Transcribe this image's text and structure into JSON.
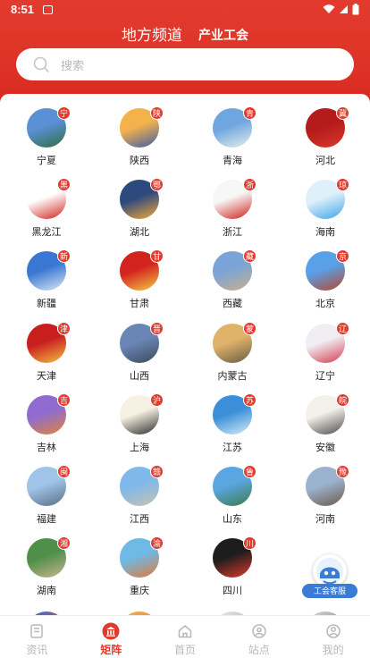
{
  "status_bar": {
    "time": "8:51",
    "wifi_icon": "wifi-icon",
    "signal_icon": "signal-icon",
    "battery_icon": "battery-icon"
  },
  "header": {
    "tab_active": "地方频道",
    "tab_other": "产业工会"
  },
  "search": {
    "placeholder": "搜索",
    "icon": "search-icon"
  },
  "regions": [
    {
      "name": "宁夏",
      "badge": "宁",
      "colors": [
        "#5b8fd6",
        "#2e6e3e"
      ]
    },
    {
      "name": "陕西",
      "badge": "陕",
      "colors": [
        "#f4b24b",
        "#3b5da8"
      ]
    },
    {
      "name": "青海",
      "badge": "青",
      "colors": [
        "#6fa6df",
        "#e7efe9"
      ]
    },
    {
      "name": "河北",
      "badge": "冀",
      "colors": [
        "#b51b1b",
        "#d8382b"
      ]
    },
    {
      "name": "黑龙江",
      "badge": "黑",
      "colors": [
        "#ffffff",
        "#d0211c"
      ]
    },
    {
      "name": "湖北",
      "badge": "鄂",
      "colors": [
        "#2d4a7e",
        "#f3a93a"
      ]
    },
    {
      "name": "浙江",
      "badge": "浙",
      "colors": [
        "#f7f7f7",
        "#d0211c"
      ]
    },
    {
      "name": "海南",
      "badge": "琼",
      "colors": [
        "#dff0fb",
        "#3ea6e6"
      ]
    },
    {
      "name": "新疆",
      "badge": "新",
      "colors": [
        "#3a77d2",
        "#dbe7f6"
      ]
    },
    {
      "name": "甘肃",
      "badge": "甘",
      "colors": [
        "#d3231d",
        "#f3c948"
      ]
    },
    {
      "name": "西藏",
      "badge": "藏",
      "colors": [
        "#7aa4d6",
        "#c9b08e"
      ]
    },
    {
      "name": "北京",
      "badge": "京",
      "colors": [
        "#5aa0e8",
        "#b5462c"
      ]
    },
    {
      "name": "天津",
      "badge": "津",
      "colors": [
        "#c81e1e",
        "#f4c043"
      ]
    },
    {
      "name": "山西",
      "badge": "晋",
      "colors": [
        "#6a86b5",
        "#3b4a5c"
      ]
    },
    {
      "name": "内蒙古",
      "badge": "蒙",
      "colors": [
        "#e0b36a",
        "#6b5b44"
      ]
    },
    {
      "name": "辽宁",
      "badge": "辽",
      "colors": [
        "#f0eef3",
        "#d63a4f"
      ]
    },
    {
      "name": "吉林",
      "badge": "吉",
      "colors": [
        "#8f6bd0",
        "#e0853a"
      ]
    },
    {
      "name": "上海",
      "badge": "沪",
      "colors": [
        "#f7f1e3",
        "#2b2b2b"
      ]
    },
    {
      "name": "江苏",
      "badge": "苏",
      "colors": [
        "#3a8fd8",
        "#d7ecf8"
      ]
    },
    {
      "name": "安徽",
      "badge": "皖",
      "colors": [
        "#f4f0ea",
        "#4d4d4d"
      ]
    },
    {
      "name": "福建",
      "badge": "闽",
      "colors": [
        "#9fc4e8",
        "#5a6f86"
      ]
    },
    {
      "name": "江西",
      "badge": "赣",
      "colors": [
        "#7fb8ea",
        "#c9c2b5"
      ]
    },
    {
      "name": "山东",
      "badge": "鲁",
      "colors": [
        "#5aa6e0",
        "#3c7a4e"
      ]
    },
    {
      "name": "河南",
      "badge": "豫",
      "colors": [
        "#9bb3cf",
        "#6d5a4a"
      ]
    },
    {
      "name": "湖南",
      "badge": "湘",
      "colors": [
        "#4f8f4a",
        "#c9b58f"
      ]
    },
    {
      "name": "重庆",
      "badge": "渝",
      "colors": [
        "#6fb9e6",
        "#e07a3a"
      ]
    },
    {
      "name": "四川",
      "badge": "川",
      "colors": [
        "#1d1d1d",
        "#e23b2e"
      ]
    }
  ],
  "float_button": {
    "label": "工会客服",
    "icon": "customer-service-icon"
  },
  "nav": [
    {
      "label": "资讯",
      "icon": "news-icon",
      "active": false
    },
    {
      "label": "矩阵",
      "icon": "matrix-icon",
      "active": true
    },
    {
      "label": "首页",
      "icon": "home-icon",
      "active": false
    },
    {
      "label": "站点",
      "icon": "location-icon",
      "active": false
    },
    {
      "label": "我的",
      "icon": "profile-icon",
      "active": false
    }
  ],
  "colors": {
    "brand_red": "#e23b2e",
    "inactive_grey": "#b8b8b8"
  }
}
